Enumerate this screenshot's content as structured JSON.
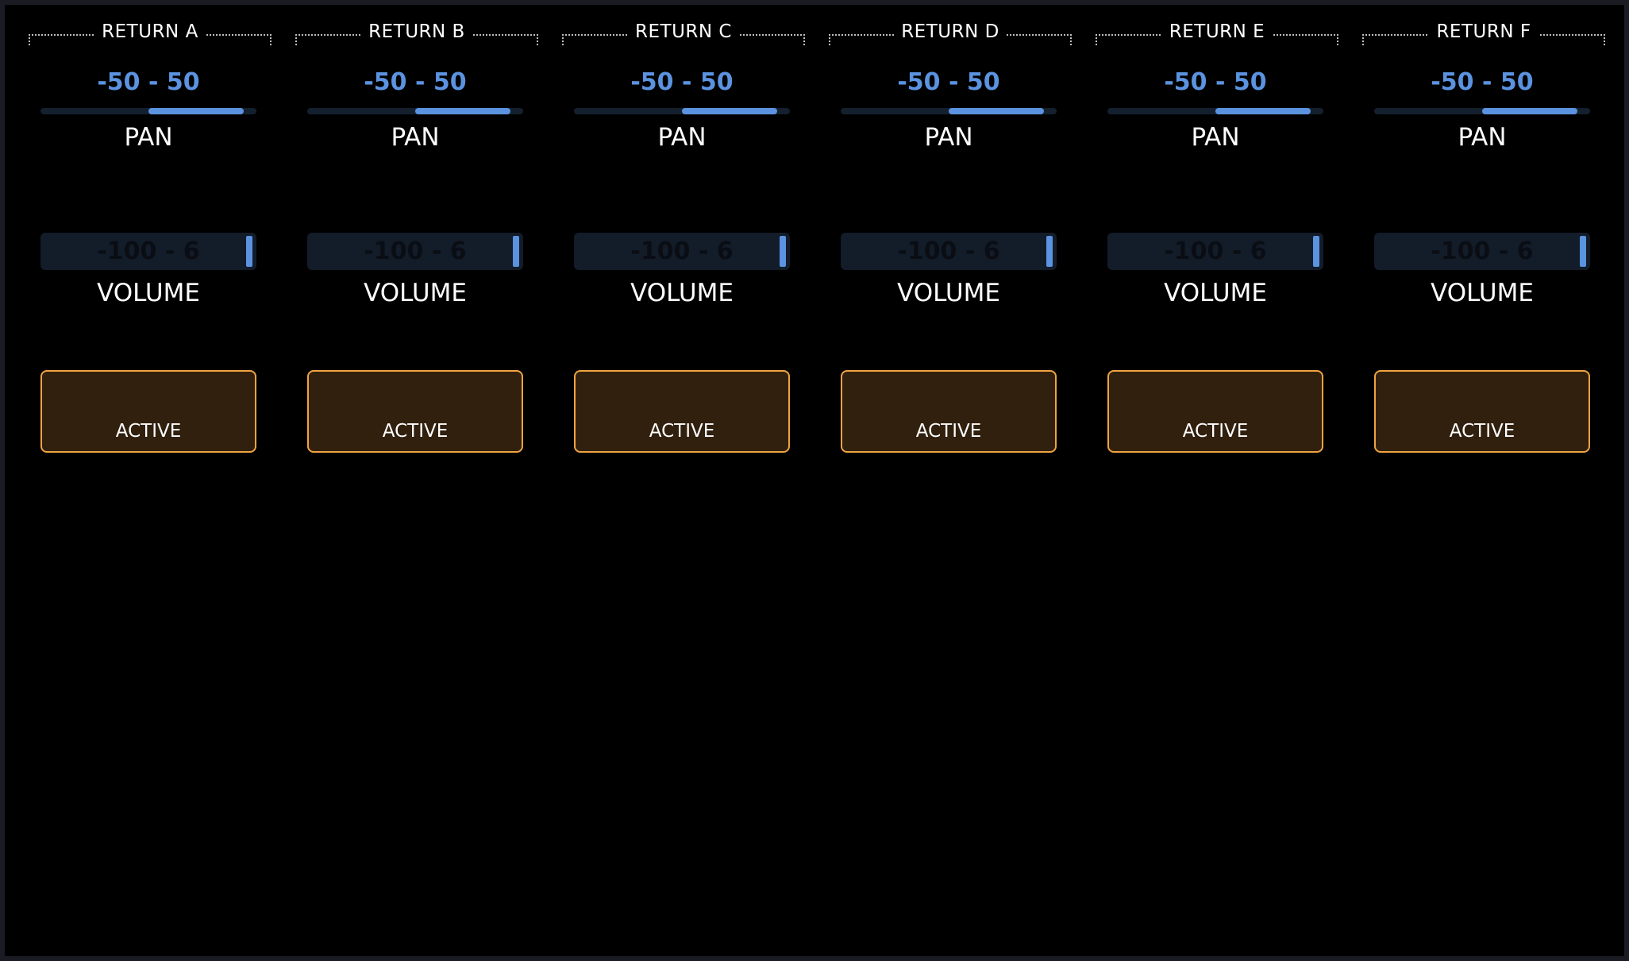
{
  "colors": {
    "background": "#000000",
    "accent_blue": "#5b93e0",
    "track_dark": "#131c29",
    "button_border_orange": "#f0a440",
    "button_fill": "#31200e",
    "text": "#ffffff"
  },
  "strips": [
    {
      "title": "RETURN A",
      "pan": {
        "range_text": "-50 - 50",
        "label": "PAN",
        "fill_start": 0.5,
        "fill_end": 0.94
      },
      "volume": {
        "range_text": "-100 - 6",
        "label": "VOLUME",
        "level": 0.98
      },
      "active_label": "ACTIVE"
    },
    {
      "title": "RETURN B",
      "pan": {
        "range_text": "-50 - 50",
        "label": "PAN",
        "fill_start": 0.5,
        "fill_end": 0.94
      },
      "volume": {
        "range_text": "-100 - 6",
        "label": "VOLUME",
        "level": 0.98
      },
      "active_label": "ACTIVE"
    },
    {
      "title": "RETURN C",
      "pan": {
        "range_text": "-50 - 50",
        "label": "PAN",
        "fill_start": 0.5,
        "fill_end": 0.94
      },
      "volume": {
        "range_text": "-100 - 6",
        "label": "VOLUME",
        "level": 0.98
      },
      "active_label": "ACTIVE"
    },
    {
      "title": "RETURN D",
      "pan": {
        "range_text": "-50 - 50",
        "label": "PAN",
        "fill_start": 0.5,
        "fill_end": 0.94
      },
      "volume": {
        "range_text": "-100 - 6",
        "label": "VOLUME",
        "level": 0.98
      },
      "active_label": "ACTIVE"
    },
    {
      "title": "RETURN E",
      "pan": {
        "range_text": "-50 - 50",
        "label": "PAN",
        "fill_start": 0.5,
        "fill_end": 0.94
      },
      "volume": {
        "range_text": "-100 - 6",
        "label": "VOLUME",
        "level": 0.98
      },
      "active_label": "ACTIVE"
    },
    {
      "title": "RETURN F",
      "pan": {
        "range_text": "-50 - 50",
        "label": "PAN",
        "fill_start": 0.5,
        "fill_end": 0.94
      },
      "volume": {
        "range_text": "-100 - 6",
        "label": "VOLUME",
        "level": 0.98
      },
      "active_label": "ACTIVE"
    }
  ]
}
